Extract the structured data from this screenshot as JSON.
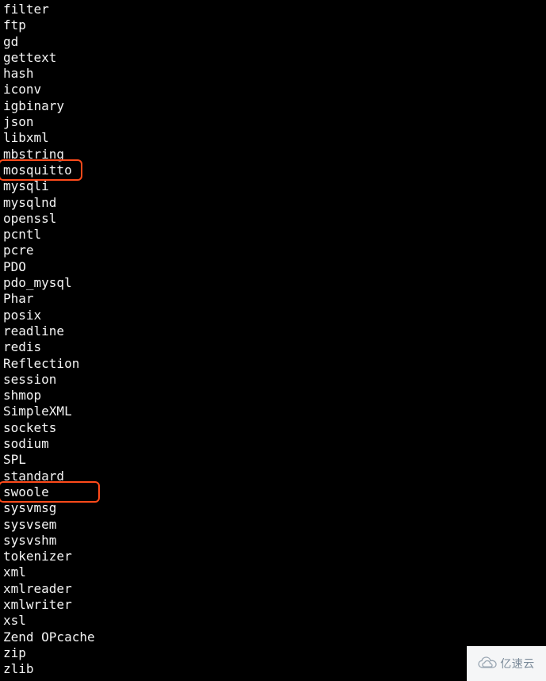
{
  "terminal": {
    "lines": [
      "filter",
      "ftp",
      "gd",
      "gettext",
      "hash",
      "iconv",
      "igbinary",
      "json",
      "libxml",
      "mbstring",
      "mosquitto",
      "mysqli",
      "mysqlnd",
      "openssl",
      "pcntl",
      "pcre",
      "PDO",
      "pdo_mysql",
      "Phar",
      "posix",
      "readline",
      "redis",
      "Reflection",
      "session",
      "shmop",
      "SimpleXML",
      "sockets",
      "sodium",
      "SPL",
      "standard",
      "swoole",
      "sysvmsg",
      "sysvsem",
      "sysvshm",
      "tokenizer",
      "xml",
      "xmlreader",
      "xmlwriter",
      "xsl",
      "Zend OPcache",
      "zip",
      "zlib"
    ],
    "highlighted": [
      "mosquitto",
      "swoole"
    ]
  },
  "watermark": {
    "text": "亿速云"
  }
}
